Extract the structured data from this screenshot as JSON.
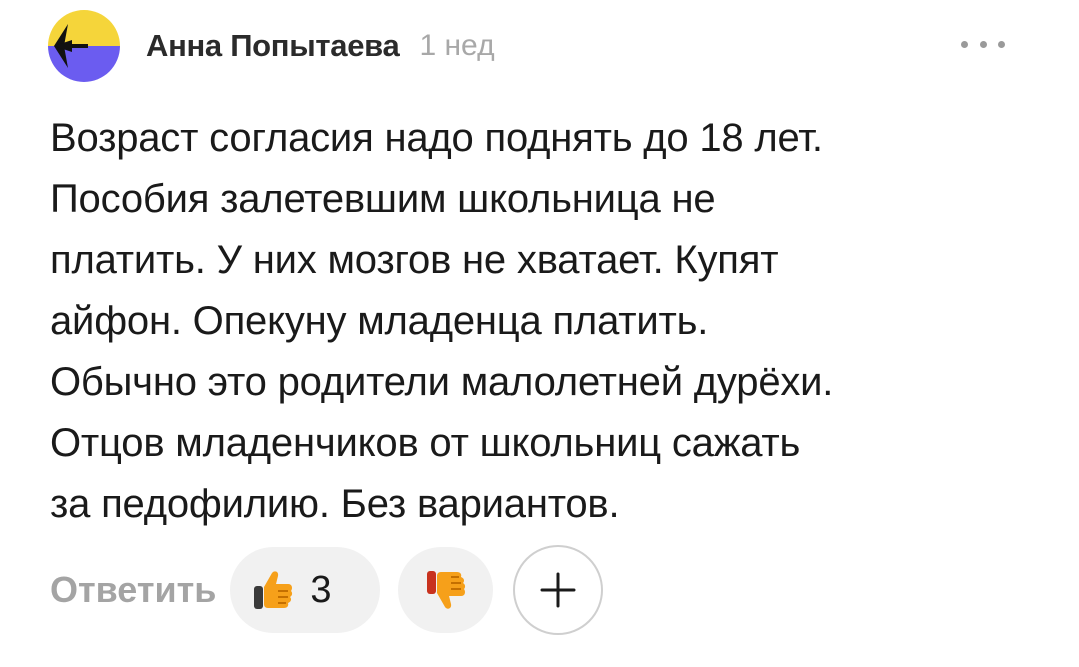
{
  "comment": {
    "author": "Анна Попытаева",
    "time": "1 нед",
    "avatar_icon": "avatar-yellow-blue-icon",
    "more_icon": "more-dots-icon",
    "lines": [
      "Возраст согласия надо поднять до 18 лет.",
      "Пособия залетевшим школьница не",
      "платить. У них мозгов не хватает. Купят",
      "айфон. Опекуну младенца платить.",
      "Обычно это родители малолетней дурёхи.",
      "Отцов младенчиков от школьниц сажать",
      "за педофилию. Без вариантов."
    ]
  },
  "actions": {
    "reply_label": "Ответить",
    "like_icon": "thumbs-up-icon",
    "like_count": "3",
    "dislike_icon": "thumbs-down-icon",
    "add_reaction_icon": "plus-icon"
  },
  "colors": {
    "avatar_yellow": "#f5d53a",
    "avatar_blue": "#6b5cf0",
    "muted_text": "#a4a4a4",
    "pill_bg": "#f1f1f1",
    "reaction_orange": "#f6a01a"
  }
}
